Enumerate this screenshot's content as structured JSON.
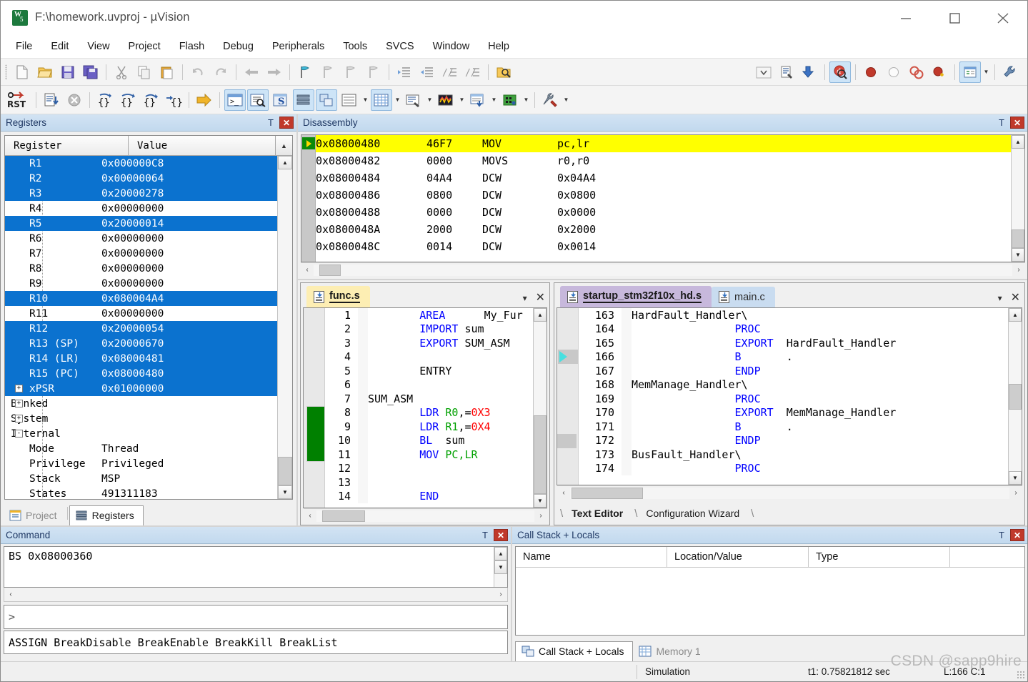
{
  "window": {
    "title": "F:\\homework.uvproj - µVision",
    "minimize": "–",
    "maximize": "□",
    "close": "✕"
  },
  "menu": {
    "items": [
      "File",
      "Edit",
      "View",
      "Project",
      "Flash",
      "Debug",
      "Peripherals",
      "Tools",
      "SVCS",
      "Window",
      "Help"
    ]
  },
  "toolbar_main": {
    "buttons": [
      {
        "name": "new-file-icon",
        "glyph": "🗋"
      },
      {
        "name": "open-file-icon",
        "glyph": "📂"
      },
      {
        "name": "save-icon",
        "glyph": "💾"
      },
      {
        "name": "save-all-icon",
        "glyph": "🖫"
      },
      {
        "name": "cut-icon",
        "glyph": "✂"
      },
      {
        "name": "copy-icon",
        "glyph": "⧉"
      },
      {
        "name": "paste-icon",
        "glyph": "📋"
      },
      {
        "name": "undo-icon",
        "glyph": "↶"
      },
      {
        "name": "redo-icon",
        "glyph": "↷"
      },
      {
        "name": "navigate-back-icon",
        "glyph": "←"
      },
      {
        "name": "navigate-forward-icon",
        "glyph": "→"
      },
      {
        "name": "bookmark-toggle-icon",
        "glyph": "⚑"
      },
      {
        "name": "bookmark-prev-icon",
        "glyph": "⚑"
      },
      {
        "name": "bookmark-next-icon",
        "glyph": "⚑"
      },
      {
        "name": "bookmark-clear-icon",
        "glyph": "⚑"
      },
      {
        "name": "indent-icon",
        "glyph": "⇥"
      },
      {
        "name": "outdent-icon",
        "glyph": "⇤"
      },
      {
        "name": "comment-icon",
        "glyph": "//"
      },
      {
        "name": "uncomment-icon",
        "glyph": "//"
      },
      {
        "name": "find-in-files-icon",
        "glyph": "🔍"
      },
      {
        "name": "combo-dropdown",
        "glyph": "⌄"
      },
      {
        "name": "target-options-icon",
        "glyph": "🗒"
      },
      {
        "name": "manage-run-time-icon",
        "glyph": "⬇"
      },
      {
        "name": "start-stop-debug-icon",
        "glyph": "ⓓ"
      },
      {
        "name": "insert-breakpoint-icon",
        "glyph": "●"
      },
      {
        "name": "disable-breakpoint-icon",
        "glyph": "○"
      },
      {
        "name": "disable-all-breakpoints-icon",
        "glyph": "◎"
      },
      {
        "name": "kill-all-breakpoints-icon",
        "glyph": "●"
      },
      {
        "name": "debug-windows-icon",
        "glyph": "▤"
      },
      {
        "name": "configuration-icon",
        "glyph": "🔧"
      }
    ]
  },
  "toolbar_debug": {
    "buttons": [
      {
        "name": "reset-cpu-icon",
        "glyph": "RST"
      },
      {
        "name": "run-icon",
        "glyph": "≣"
      },
      {
        "name": "stop-icon",
        "glyph": "✕"
      },
      {
        "name": "step-icon",
        "glyph": "{→}"
      },
      {
        "name": "step-over-icon",
        "glyph": "{}→"
      },
      {
        "name": "step-out-icon",
        "glyph": "{}↱"
      },
      {
        "name": "run-to-cursor-icon",
        "glyph": "→{}"
      },
      {
        "name": "show-next-statement-icon",
        "glyph": "⇨"
      },
      {
        "name": "command-window-icon",
        "glyph": "⌫"
      },
      {
        "name": "disassembly-window-icon",
        "glyph": "🔎"
      },
      {
        "name": "symbols-window-icon",
        "glyph": "S"
      },
      {
        "name": "registers-window-icon",
        "glyph": "≣"
      },
      {
        "name": "call-stack-window-icon",
        "glyph": "⧉"
      },
      {
        "name": "watch-windows-icon",
        "glyph": "▦"
      },
      {
        "name": "memory-windows-icon",
        "glyph": "▦"
      },
      {
        "name": "serial-windows-icon",
        "glyph": "☰"
      },
      {
        "name": "analysis-windows-icon",
        "glyph": "〜"
      },
      {
        "name": "trace-windows-icon",
        "glyph": "▤"
      },
      {
        "name": "system-viewer-icon",
        "glyph": "▣"
      },
      {
        "name": "toolbox-icon",
        "glyph": "⚒"
      }
    ]
  },
  "registers_panel": {
    "title": "Registers",
    "pin_icon": "Τ",
    "close_icon": "✕",
    "columns": [
      "Register",
      "Value"
    ],
    "rows": [
      {
        "name": "R1",
        "value": "0x000000C8",
        "selected": true,
        "indent": 1,
        "expander": ""
      },
      {
        "name": "R2",
        "value": "0x00000064",
        "selected": true,
        "indent": 1,
        "expander": ""
      },
      {
        "name": "R3",
        "value": "0x20000278",
        "selected": true,
        "indent": 1,
        "expander": ""
      },
      {
        "name": "R4",
        "value": "0x00000000",
        "selected": false,
        "indent": 1,
        "expander": ""
      },
      {
        "name": "R5",
        "value": "0x20000014",
        "selected": true,
        "indent": 1,
        "expander": ""
      },
      {
        "name": "R6",
        "value": "0x00000000",
        "selected": false,
        "indent": 1,
        "expander": ""
      },
      {
        "name": "R7",
        "value": "0x00000000",
        "selected": false,
        "indent": 1,
        "expander": ""
      },
      {
        "name": "R8",
        "value": "0x00000000",
        "selected": false,
        "indent": 1,
        "expander": ""
      },
      {
        "name": "R9",
        "value": "0x00000000",
        "selected": false,
        "indent": 1,
        "expander": ""
      },
      {
        "name": "R10",
        "value": "0x080004A4",
        "selected": true,
        "indent": 1,
        "expander": ""
      },
      {
        "name": "R11",
        "value": "0x00000000",
        "selected": false,
        "indent": 1,
        "expander": ""
      },
      {
        "name": "R12",
        "value": "0x20000054",
        "selected": true,
        "indent": 1,
        "expander": ""
      },
      {
        "name": "R13 (SP)",
        "value": "0x20000670",
        "selected": true,
        "indent": 1,
        "expander": ""
      },
      {
        "name": "R14 (LR)",
        "value": "0x08000481",
        "selected": true,
        "indent": 1,
        "expander": ""
      },
      {
        "name": "R15 (PC)",
        "value": "0x08000480",
        "selected": true,
        "indent": 1,
        "expander": ""
      },
      {
        "name": "xPSR",
        "value": "0x01000000",
        "selected": true,
        "indent": 1,
        "expander": "+"
      },
      {
        "name": "Banked",
        "value": "",
        "selected": false,
        "indent": 0,
        "expander": "+"
      },
      {
        "name": "System",
        "value": "",
        "selected": false,
        "indent": 0,
        "expander": "+"
      },
      {
        "name": "Internal",
        "value": "",
        "selected": false,
        "indent": 0,
        "expander": "-"
      },
      {
        "name": "Mode",
        "value": "Thread",
        "selected": false,
        "indent": 1,
        "expander": ""
      },
      {
        "name": "Privilege",
        "value": "Privileged",
        "selected": false,
        "indent": 1,
        "expander": ""
      },
      {
        "name": "Stack",
        "value": "MSP",
        "selected": false,
        "indent": 1,
        "expander": ""
      },
      {
        "name": "States",
        "value": "491311183",
        "selected": false,
        "indent": 1,
        "expander": ""
      }
    ]
  },
  "left_bottom_tabs": [
    {
      "label": "Project",
      "icon": "project-icon",
      "active": false
    },
    {
      "label": "Registers",
      "icon": "registers-icon",
      "active": true
    }
  ],
  "disassembly_panel": {
    "title": "Disassembly",
    "pin_icon": "Τ",
    "close_icon": "✕",
    "lines": [
      {
        "address": "0x08000480",
        "opcode": "46F7",
        "mnemonic": "MOV",
        "operands": "pc,lr",
        "current": true
      },
      {
        "address": "0x08000482",
        "opcode": "0000",
        "mnemonic": "MOVS",
        "operands": "r0,r0",
        "current": false
      },
      {
        "address": "0x08000484",
        "opcode": "04A4",
        "mnemonic": "DCW",
        "operands": "0x04A4",
        "current": false
      },
      {
        "address": "0x08000486",
        "opcode": "0800",
        "mnemonic": "DCW",
        "operands": "0x0800",
        "current": false
      },
      {
        "address": "0x08000488",
        "opcode": "0000",
        "mnemonic": "DCW",
        "operands": "0x0000",
        "current": false
      },
      {
        "address": "0x0800048A",
        "opcode": "2000",
        "mnemonic": "DCW",
        "operands": "0x2000",
        "current": false
      },
      {
        "address": "0x0800048C",
        "opcode": "0014",
        "mnemonic": "DCW",
        "operands": "0x0014",
        "current": false
      }
    ]
  },
  "editor_left": {
    "tabs": [
      {
        "label": "func.s",
        "active": true,
        "color": "yellow"
      }
    ],
    "dropdown_icon": "▾",
    "close_icon": "✕",
    "lines": [
      {
        "n": "1",
        "segments": [
          {
            "t": "        ",
            "c": "plain"
          },
          {
            "t": "AREA",
            "c": "kw"
          },
          {
            "t": "      ",
            "c": "plain"
          },
          {
            "t": "My_Fur",
            "c": "plain"
          }
        ]
      },
      {
        "n": "2",
        "segments": [
          {
            "t": "        ",
            "c": "plain"
          },
          {
            "t": "IMPORT",
            "c": "kw"
          },
          {
            "t": " sum",
            "c": "plain"
          }
        ]
      },
      {
        "n": "3",
        "segments": [
          {
            "t": "        ",
            "c": "plain"
          },
          {
            "t": "EXPORT",
            "c": "kw"
          },
          {
            "t": " SUM_ASM",
            "c": "plain"
          }
        ]
      },
      {
        "n": "4",
        "segments": []
      },
      {
        "n": "5",
        "segments": [
          {
            "t": "        ENTRY",
            "c": "plain"
          }
        ]
      },
      {
        "n": "6",
        "segments": []
      },
      {
        "n": "7",
        "segments": [
          {
            "t": "SUM_ASM",
            "c": "plain"
          }
        ]
      },
      {
        "n": "8",
        "segments": [
          {
            "t": "        ",
            "c": "plain"
          },
          {
            "t": "LDR",
            "c": "kw"
          },
          {
            "t": " ",
            "c": "plain"
          },
          {
            "t": "R0",
            "c": "reg"
          },
          {
            "t": ",=",
            "c": "plain"
          },
          {
            "t": "0X3",
            "c": "num"
          }
        ]
      },
      {
        "n": "9",
        "segments": [
          {
            "t": "        ",
            "c": "plain"
          },
          {
            "t": "LDR",
            "c": "kw"
          },
          {
            "t": " ",
            "c": "plain"
          },
          {
            "t": "R1",
            "c": "reg"
          },
          {
            "t": ",=",
            "c": "plain"
          },
          {
            "t": "0X4",
            "c": "num"
          }
        ]
      },
      {
        "n": "10",
        "segments": [
          {
            "t": "        ",
            "c": "plain"
          },
          {
            "t": "BL",
            "c": "kw"
          },
          {
            "t": "  sum",
            "c": "plain"
          }
        ]
      },
      {
        "n": "11",
        "segments": [
          {
            "t": "        ",
            "c": "plain"
          },
          {
            "t": "MOV",
            "c": "kw"
          },
          {
            "t": " ",
            "c": "plain"
          },
          {
            "t": "PC,LR",
            "c": "reg"
          }
        ]
      },
      {
        "n": "12",
        "segments": []
      },
      {
        "n": "13",
        "segments": []
      },
      {
        "n": "14",
        "segments": [
          {
            "t": "        ",
            "c": "plain"
          },
          {
            "t": "END",
            "c": "kw"
          }
        ]
      }
    ]
  },
  "editor_right": {
    "tabs": [
      {
        "label": "startup_stm32f10x_hd.s",
        "active": true,
        "color": "purple"
      },
      {
        "label": "main.c",
        "active": false,
        "color": "blue"
      }
    ],
    "dropdown_icon": "▾",
    "close_icon": "✕",
    "lines": [
      {
        "n": "163",
        "segments": [
          {
            "t": "HardFault_Handler\\",
            "c": "plain"
          }
        ]
      },
      {
        "n": "164",
        "segments": [
          {
            "t": "                ",
            "c": "plain"
          },
          {
            "t": "PROC",
            "c": "kw"
          }
        ]
      },
      {
        "n": "165",
        "segments": [
          {
            "t": "                ",
            "c": "plain"
          },
          {
            "t": "EXPORT",
            "c": "kw"
          },
          {
            "t": "  HardFault_Handler",
            "c": "plain"
          }
        ]
      },
      {
        "n": "166",
        "segments": [
          {
            "t": "                ",
            "c": "plain"
          },
          {
            "t": "B",
            "c": "kw"
          },
          {
            "t": "       .",
            "c": "plain"
          }
        ]
      },
      {
        "n": "167",
        "segments": [
          {
            "t": "                ",
            "c": "plain"
          },
          {
            "t": "ENDP",
            "c": "kw"
          }
        ]
      },
      {
        "n": "168",
        "segments": [
          {
            "t": "MemManage_Handler\\",
            "c": "plain"
          }
        ]
      },
      {
        "n": "169",
        "segments": [
          {
            "t": "                ",
            "c": "plain"
          },
          {
            "t": "PROC",
            "c": "kw"
          }
        ]
      },
      {
        "n": "170",
        "segments": [
          {
            "t": "                ",
            "c": "plain"
          },
          {
            "t": "EXPORT",
            "c": "kw"
          },
          {
            "t": "  MemManage_Handler",
            "c": "plain"
          }
        ]
      },
      {
        "n": "171",
        "segments": [
          {
            "t": "                ",
            "c": "plain"
          },
          {
            "t": "B",
            "c": "kw"
          },
          {
            "t": "       .",
            "c": "plain"
          }
        ]
      },
      {
        "n": "172",
        "segments": [
          {
            "t": "                ",
            "c": "plain"
          },
          {
            "t": "ENDP",
            "c": "kw"
          }
        ]
      },
      {
        "n": "173",
        "segments": [
          {
            "t": "BusFault_Handler\\",
            "c": "plain"
          }
        ]
      },
      {
        "n": "174",
        "segments": [
          {
            "t": "                ",
            "c": "plain"
          },
          {
            "t": "PROC",
            "c": "kw"
          }
        ]
      }
    ],
    "bottom_tabs": [
      {
        "label": "Text Editor",
        "active": true
      },
      {
        "label": "Configuration Wizard",
        "active": false
      }
    ]
  },
  "command_panel": {
    "title": "Command",
    "pin_icon": "Τ",
    "close_icon": "✕",
    "output": "BS 0x08000360",
    "prompt": ">",
    "input_value": "",
    "help_line": "ASSIGN BreakDisable BreakEnable BreakKill BreakList"
  },
  "callstack_panel": {
    "title": "Call Stack + Locals",
    "pin_icon": "Τ",
    "close_icon": "✕",
    "columns": [
      "Name",
      "Location/Value",
      "Type",
      ""
    ],
    "rows": [],
    "tabs": [
      {
        "label": "Call Stack + Locals",
        "icon": "call-stack-icon",
        "active": true
      },
      {
        "label": "Memory 1",
        "icon": "memory-icon",
        "active": false
      }
    ]
  },
  "statusbar": {
    "mode": "Simulation",
    "time": "t1: 0.75821812 sec",
    "cursor": "L:166 C:1"
  },
  "watermark": "CSDN @sapp9hire",
  "colors": {
    "selection_blue": "#0b72cf",
    "current_line_yellow": "#ffff00",
    "panel_header_blue": "#cadef1",
    "tab_yellow": "#fdeeb3",
    "tab_purple": "#c7b8dc",
    "tab_blue": "#c9dcf0",
    "keyword_blue": "#0000ff",
    "register_green": "#00a000",
    "number_red": "#ff0000",
    "modified_green": "#008000",
    "close_red": "#c0392b"
  }
}
